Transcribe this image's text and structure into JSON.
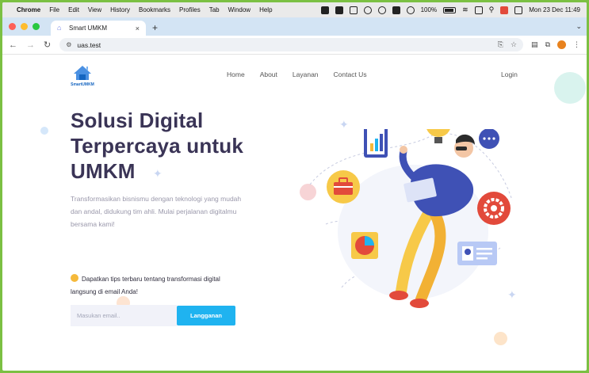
{
  "menubar": {
    "app": "Chrome",
    "items": [
      "File",
      "Edit",
      "View",
      "History",
      "Bookmarks",
      "Profiles",
      "Tab",
      "Window",
      "Help"
    ],
    "battery": "100%",
    "datetime": "Mon 23 Dec 11:49"
  },
  "tab": {
    "title": "Smart UMKM",
    "close": "×",
    "new_tab": "+"
  },
  "address": {
    "url": "uas.test"
  },
  "site": {
    "logo_text": "SmartUMKM",
    "nav": [
      "Home",
      "About",
      "Layanan",
      "Contact Us"
    ],
    "login": "Login"
  },
  "hero": {
    "title": "Solusi Digital Terpercaya untuk UMKM",
    "description": "Transformasikan bisnismu dengan teknologi yang mudah dan andal, didukung tim ahli. Mulai perjalanan digitalmu bersama kami!"
  },
  "newsletter": {
    "tips": "Dapatkan tips terbaru tentang transformasi digital langsung di email Anda!",
    "email_placeholder": "Masukan email..",
    "button": "Langganan"
  },
  "colors": {
    "accent": "#1fb3f0",
    "title": "#3a3456",
    "frame": "#7bc043"
  }
}
